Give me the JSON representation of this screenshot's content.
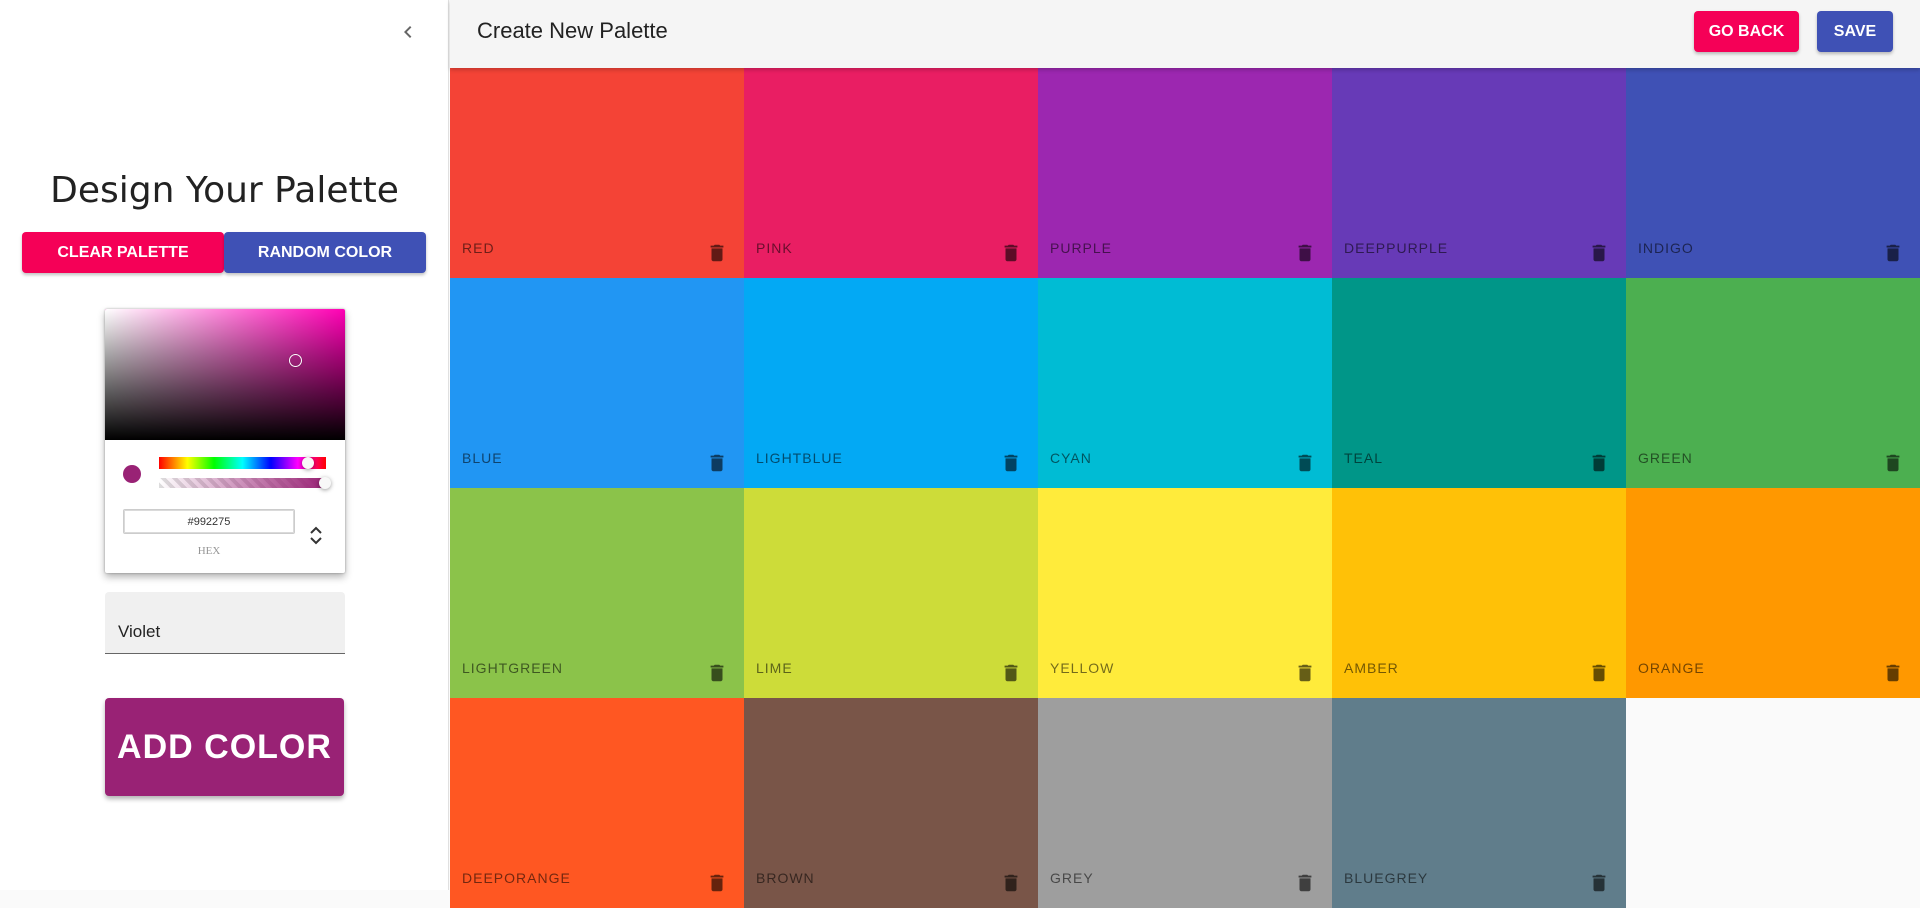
{
  "drawer": {
    "title": "Design Your Palette",
    "clear_label": "CLEAR PALETTE",
    "random_label": "RANDOM COLOR",
    "picker": {
      "hex_value": "#992275",
      "hex_label": "HEX",
      "current_color": "#992275",
      "hue_position": 0.9,
      "alpha_position": 1.0
    },
    "name_value": "Violet",
    "add_label": "ADD COLOR",
    "add_color": "#992275"
  },
  "appbar": {
    "title": "Create New Palette",
    "goback_label": "GO BACK",
    "save_label": "SAVE",
    "goback_color": "#f50057",
    "save_color": "#3f51b5"
  },
  "colors": [
    {
      "name": "red",
      "color": "#f44336"
    },
    {
      "name": "pink",
      "color": "#e91e63"
    },
    {
      "name": "purple",
      "color": "#9c27b0"
    },
    {
      "name": "deeppurple",
      "color": "#673ab7"
    },
    {
      "name": "indigo",
      "color": "#3f51b5"
    },
    {
      "name": "blue",
      "color": "#2196f3"
    },
    {
      "name": "lightblue",
      "color": "#03a9f4"
    },
    {
      "name": "cyan",
      "color": "#00bcd4"
    },
    {
      "name": "teal",
      "color": "#009688"
    },
    {
      "name": "green",
      "color": "#4caf50"
    },
    {
      "name": "lightgreen",
      "color": "#8bc34a"
    },
    {
      "name": "lime",
      "color": "#cddc39"
    },
    {
      "name": "yellow",
      "color": "#ffeb3b"
    },
    {
      "name": "amber",
      "color": "#ffc107"
    },
    {
      "name": "orange",
      "color": "#ff9800"
    },
    {
      "name": "deeporange",
      "color": "#ff5722"
    },
    {
      "name": "brown",
      "color": "#795548"
    },
    {
      "name": "grey",
      "color": "#9e9e9e"
    },
    {
      "name": "bluegrey",
      "color": "#607d8b"
    }
  ]
}
